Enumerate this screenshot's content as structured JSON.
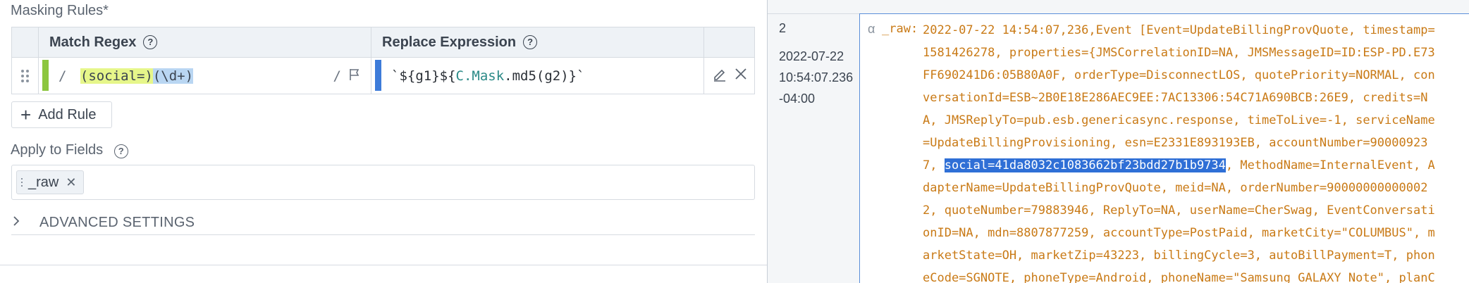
{
  "masking": {
    "title": "Masking Rules*",
    "columns": {
      "match_regex": "Match Regex",
      "replace_expression": "Replace Expression"
    },
    "help_glyph": "?",
    "rule": {
      "regex_open": "/ ",
      "regex_g1": "(social=)",
      "regex_g2": "(\\d+)",
      "regex_close": "/",
      "replace_prefix": "`${g1}${",
      "replace_cmask": "C.Mask",
      "replace_suffix": ".md5(g2)}`"
    },
    "add_rule_label": "Add Rule"
  },
  "fields": {
    "title": "Apply to Fields",
    "tokens": [
      "_raw"
    ]
  },
  "advanced": {
    "label": "ADVANCED SETTINGS"
  },
  "event": {
    "number": "2",
    "time_lines": [
      "2022-07-22",
      "10:54:07.236",
      "-04:00"
    ],
    "type_glyph": "α",
    "field_name": "_raw:",
    "lines": [
      "2022-07-22 14:54:07,236,Event [Event=UpdateBillingProvQuote, timestamp=",
      "1581426278, properties={JMSCorrelationID=NA, JMSMessageID=ID:ESP-PD.E73",
      "FF690241D6:05B80A0F, orderType=DisconnectLOS, quotePriority=NORMAL, con",
      "versationId=ESB~2B0E18E286AEC9EE:7AC13306:54C71A690BCB:26E9, credits=N",
      "A, JMSReplyTo=pub.esb.genericasync.response, timeToLive=-1, serviceName",
      "=UpdateBillingProvisioning, esn=E2331E893193EB, accountNumber=90000923"
    ],
    "line7_prefix": "7, ",
    "line7_selected": "social=41da8032c1083662bf23bdd27b1b9734",
    "line7_suffix": ", MethodName=InternalEvent, A",
    "lines_after": [
      "dapterName=UpdateBillingProvQuote, meid=NA, orderNumber=90000000000002",
      "2, quoteNumber=79883946, ReplyTo=NA, userName=CherSwag, EventConversati",
      "onID=NA, mdn=8807877259, accountType=PostPaid, marketCity=\"COLUMBUS\", m",
      "arketState=OH, marketZip=43223, billingCycle=3, autoBillPayment=T, phon",
      "eCode=SGNOTE, phoneType=Android, phoneName=\"Samsung GALAXY Note\", planC"
    ]
  },
  "colors": {
    "regex_bar": "#8cc63f",
    "replace_bar": "#3d7bd9",
    "field_text": "#c97a16",
    "selection": "#2f6fd6"
  },
  "icons": [
    "drag-handle-icon",
    "help-icon",
    "flag-icon",
    "edit-icon",
    "close-icon",
    "plus-icon",
    "chevron-right-icon",
    "remove-token-icon"
  ]
}
